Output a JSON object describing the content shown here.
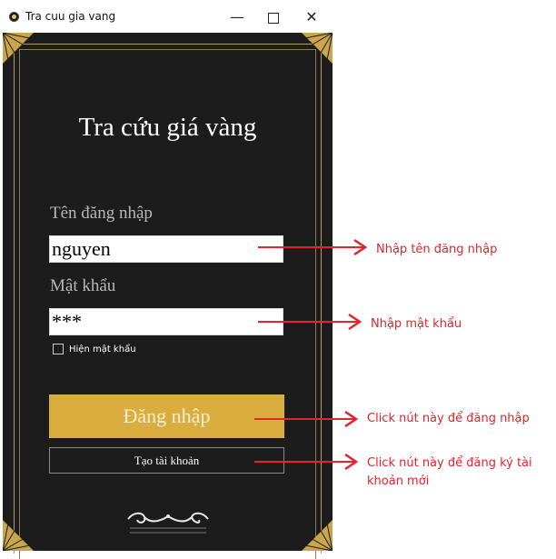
{
  "window": {
    "title": "Tra cuu gia vang",
    "minimize": "—",
    "close": "✕"
  },
  "app": {
    "heading": "Tra cứu giá vàng",
    "username_label": "Tên đăng nhập",
    "username_value": "nguyen",
    "password_label": "Mật khẩu",
    "password_value": "***",
    "show_password_label": "Hiện mật khẩu",
    "show_password_checked": false,
    "login_button": "Đăng nhập",
    "register_button": "Tạo tài khoản",
    "colors": {
      "background": "#1c1c1c",
      "gold": "#d9ad3e",
      "frame_line": "#b39a66"
    }
  },
  "annotations": {
    "username_hint": "Nhập tên đăng nhập",
    "password_hint": "Nhập mật khẩu",
    "login_hint": "Click nút này để đăng nhập",
    "register_hint": "Click nút này để đăng ký tài khoản mới",
    "color": "#e8212a"
  }
}
